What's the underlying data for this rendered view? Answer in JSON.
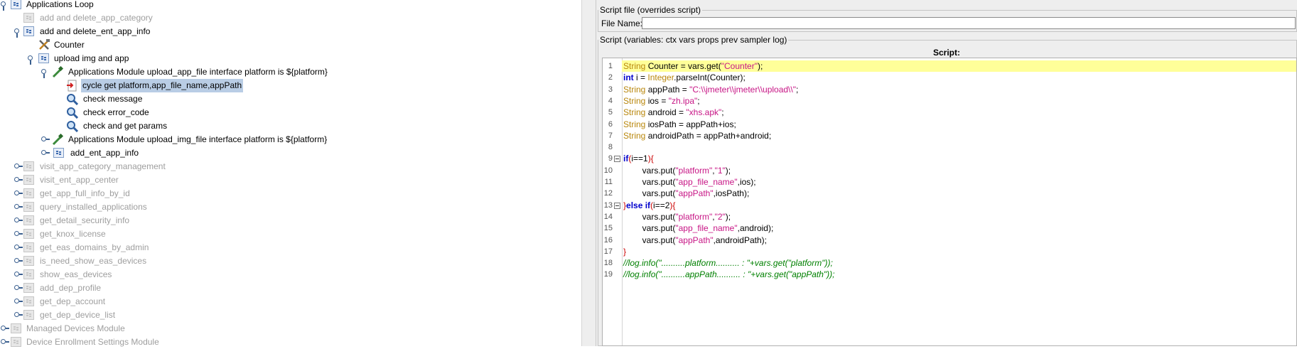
{
  "tree": {
    "root": "Applications Loop",
    "items": [
      {
        "label": "add and delete_app_category"
      },
      {
        "label": "add and delete_ent_app_info"
      },
      {
        "label": "Counter"
      },
      {
        "label": "upload img and app"
      },
      {
        "label": "Applications Module upload_app_file interface platform is ${platform}"
      },
      {
        "label": "cycle get platform,app_file_name,appPath"
      },
      {
        "label": "check message"
      },
      {
        "label": "check error_code"
      },
      {
        "label": "check and get params"
      },
      {
        "label": "Applications Module upload_img_file interface platform is ${platform}"
      },
      {
        "label": "add_ent_app_info"
      },
      {
        "label": "visit_app_category_management"
      },
      {
        "label": "visit_ent_app_center"
      },
      {
        "label": "get_app_full_info_by_id"
      },
      {
        "label": "query_installed_applications"
      },
      {
        "label": "get_detail_security_info"
      },
      {
        "label": "get_knox_license"
      },
      {
        "label": "get_eas_domains_by_admin"
      },
      {
        "label": "is_need_show_eas_devices"
      },
      {
        "label": "show_eas_devices"
      },
      {
        "label": "add_dep_profile"
      },
      {
        "label": "get_dep_account"
      },
      {
        "label": "get_dep_device_list"
      },
      {
        "label": "Managed Devices Module"
      },
      {
        "label": "Device Enrollment Settings Module"
      }
    ]
  },
  "script_file": {
    "legend": "Script file (overrides script)",
    "file_name_label": "File Name:",
    "file_name_value": ""
  },
  "script": {
    "legend": "Script (variables: ctx vars props prev sampler log)",
    "header": "Script:",
    "line_numbers": [
      "1",
      "2",
      "3",
      "4",
      "5",
      "6",
      "7",
      "8",
      "9",
      "10",
      "11",
      "12",
      "13",
      "14",
      "15",
      "16",
      "17",
      "18",
      "19"
    ],
    "lines": [
      [
        {
          "t": "String",
          "c": "type"
        },
        {
          "t": " Counter = vars.get(",
          "c": "plain"
        },
        {
          "t": "\"Counter\"",
          "c": "str"
        },
        {
          "t": ");",
          "c": "plain"
        }
      ],
      [
        {
          "t": "int",
          "c": "kw"
        },
        {
          "t": " i = ",
          "c": "plain"
        },
        {
          "t": "Integer",
          "c": "type"
        },
        {
          "t": ".parseInt(Counter);",
          "c": "plain"
        }
      ],
      [
        {
          "t": "String",
          "c": "type"
        },
        {
          "t": " appPath = ",
          "c": "plain"
        },
        {
          "t": "\"C:\\\\jmeter\\\\jmeter\\\\upload\\\\\"",
          "c": "str"
        },
        {
          "t": ";",
          "c": "plain"
        }
      ],
      [
        {
          "t": "String",
          "c": "type"
        },
        {
          "t": " ios = ",
          "c": "plain"
        },
        {
          "t": "\"zh.ipa\"",
          "c": "str"
        },
        {
          "t": ";",
          "c": "plain"
        }
      ],
      [
        {
          "t": "String",
          "c": "type"
        },
        {
          "t": " android = ",
          "c": "plain"
        },
        {
          "t": "\"xhs.apk\"",
          "c": "str"
        },
        {
          "t": ";",
          "c": "plain"
        }
      ],
      [
        {
          "t": "String",
          "c": "type"
        },
        {
          "t": " iosPath = appPath+ios;",
          "c": "plain"
        }
      ],
      [
        {
          "t": "String",
          "c": "type"
        },
        {
          "t": " androidPath = appPath+android;",
          "c": "plain"
        }
      ],
      [],
      [
        {
          "t": "if",
          "c": "kw"
        },
        {
          "t": "(",
          "c": "brace"
        },
        {
          "t": "i==1",
          "c": "plain"
        },
        {
          "t": "){",
          "c": "brace"
        }
      ],
      [
        {
          "t": "        vars.put(",
          "c": "plain"
        },
        {
          "t": "\"platform\"",
          "c": "str"
        },
        {
          "t": ",",
          "c": "plain"
        },
        {
          "t": "\"1\"",
          "c": "str"
        },
        {
          "t": ");",
          "c": "plain"
        }
      ],
      [
        {
          "t": "        vars.put(",
          "c": "plain"
        },
        {
          "t": "\"app_file_name\"",
          "c": "str"
        },
        {
          "t": ",ios);",
          "c": "plain"
        }
      ],
      [
        {
          "t": "        vars.put(",
          "c": "plain"
        },
        {
          "t": "\"appPath\"",
          "c": "str"
        },
        {
          "t": ",iosPath);",
          "c": "plain"
        }
      ],
      [
        {
          "t": "}",
          "c": "brace"
        },
        {
          "t": "else if",
          "c": "kw"
        },
        {
          "t": "(",
          "c": "brace"
        },
        {
          "t": "i==2",
          "c": "plain"
        },
        {
          "t": "){",
          "c": "brace"
        }
      ],
      [
        {
          "t": "        vars.put(",
          "c": "plain"
        },
        {
          "t": "\"platform\"",
          "c": "str"
        },
        {
          "t": ",",
          "c": "plain"
        },
        {
          "t": "\"2\"",
          "c": "str"
        },
        {
          "t": ");",
          "c": "plain"
        }
      ],
      [
        {
          "t": "        vars.put(",
          "c": "plain"
        },
        {
          "t": "\"app_file_name\"",
          "c": "str"
        },
        {
          "t": ",android);",
          "c": "plain"
        }
      ],
      [
        {
          "t": "        vars.put(",
          "c": "plain"
        },
        {
          "t": "\"appPath\"",
          "c": "str"
        },
        {
          "t": ",androidPath);",
          "c": "plain"
        }
      ],
      [
        {
          "t": "}",
          "c": "brace"
        }
      ],
      [
        {
          "t": "//log.info(\"..........platform.......... : \"+vars.get(\"platform\"));",
          "c": "cmt"
        }
      ],
      [
        {
          "t": "//log.info(\"..........appPath.......... : \"+vars.get(\"appPath\"));",
          "c": "cmt"
        }
      ]
    ]
  },
  "colors": {
    "type": "#b8860b",
    "kw": "#0000cc",
    "str": "#c71585",
    "brace": "#cc0000",
    "cmt": "#008000",
    "plain": "#000000",
    "selection": "#b9cde5",
    "current_line": "#ffff99",
    "disabled_text": "#9e9e9e"
  }
}
